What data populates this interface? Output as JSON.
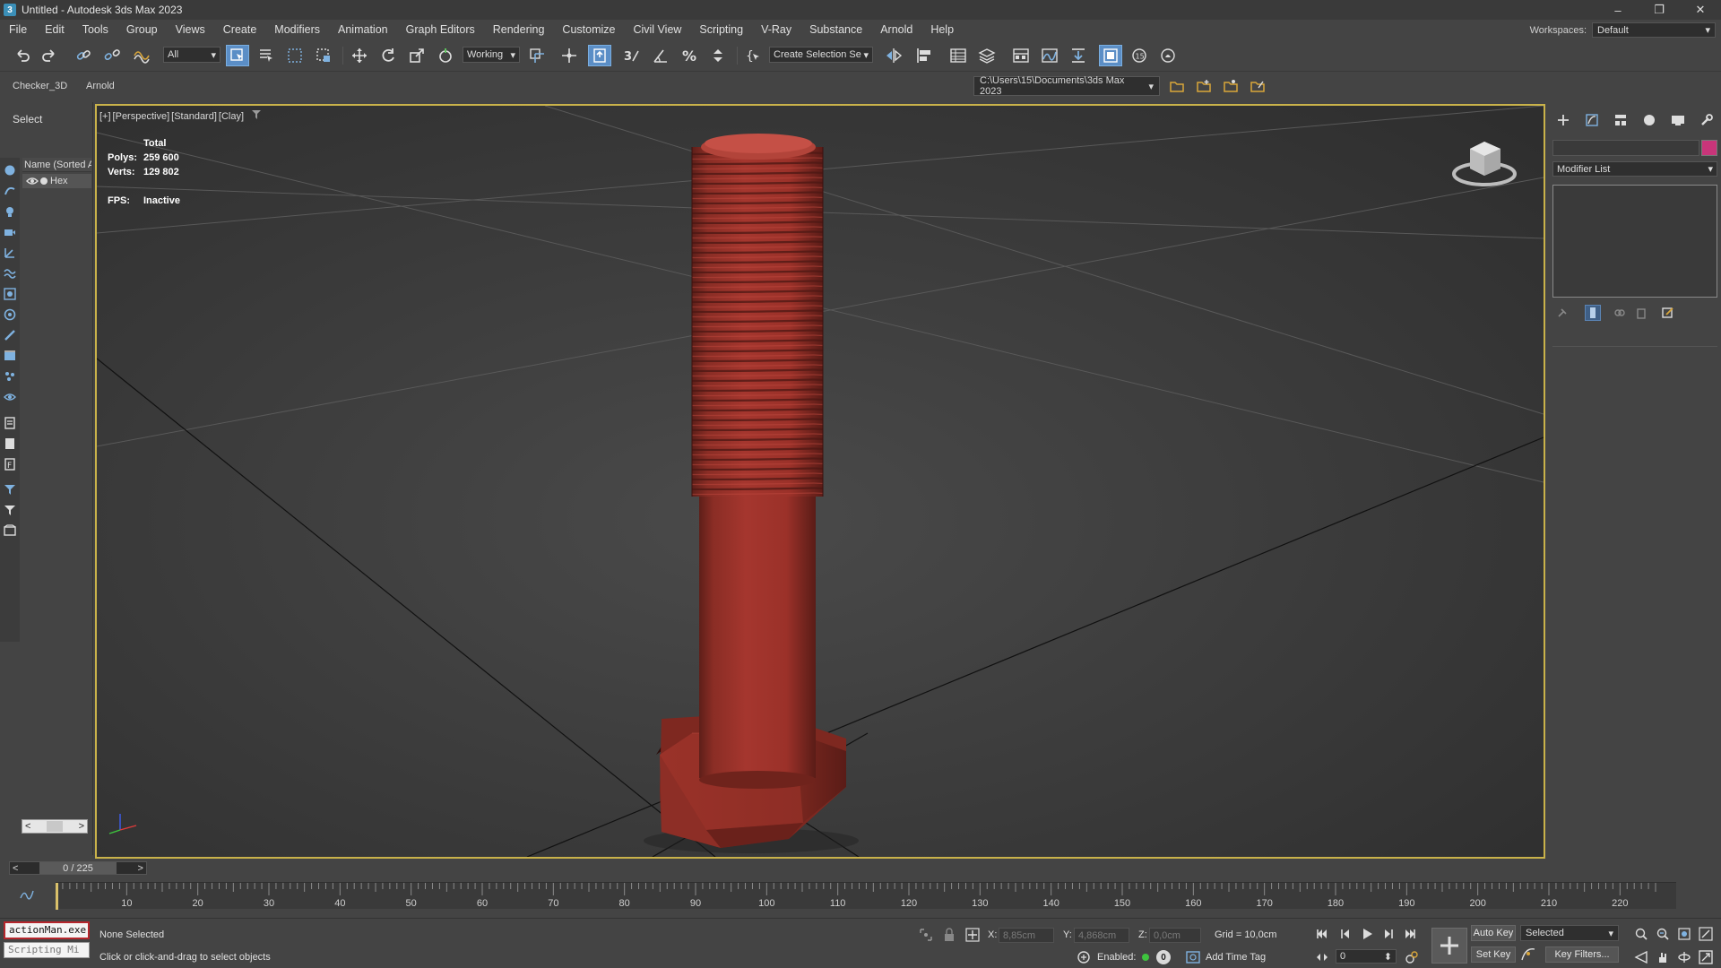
{
  "window": {
    "app_icon": "3",
    "title": "Untitled - Autodesk 3ds Max 2023",
    "controls": {
      "minimize": "–",
      "restore": "❐",
      "close": "✕"
    }
  },
  "menu": {
    "items": [
      "File",
      "Edit",
      "Tools",
      "Group",
      "Views",
      "Create",
      "Modifiers",
      "Animation",
      "Graph Editors",
      "Rendering",
      "Customize",
      "Civil View",
      "Scripting",
      "V-Ray",
      "Substance",
      "Arnold",
      "Help"
    ]
  },
  "workspace": {
    "label": "Workspaces:",
    "value": "Default"
  },
  "toolbar": {
    "selection_filter": "All",
    "reference_coord": "Working",
    "named_selection": "Create Selection Se",
    "spinner_snap_value": "15"
  },
  "ribbon": {
    "tabs": [
      "Checker_3D",
      "Arnold"
    ],
    "project_path": "C:\\Users\\15\\Documents\\3ds Max 2023"
  },
  "explorer": {
    "select_label": "Select",
    "column_header": "Name (Sorted A",
    "rows": [
      {
        "name": "Hex"
      }
    ],
    "scroll_left": "<",
    "scroll_right": ">"
  },
  "viewport": {
    "label_parts": [
      "[+]",
      "[Perspective]",
      "[Standard]",
      "[Clay]"
    ],
    "stats": {
      "header": "Total",
      "polys_label": "Polys:",
      "polys_value": "259 600",
      "verts_label": "Verts:",
      "verts_value": "129 802",
      "fps_label": "FPS:",
      "fps_value": "Inactive"
    },
    "model_color": "#a5362e",
    "active_border_color": "#c9b24a"
  },
  "command_panel": {
    "modifier_list": "Modifier List",
    "object_color": "#c9357a"
  },
  "time": {
    "slider_text": "0 / 225",
    "slider_prev": "<",
    "slider_next": ">",
    "ruler_labels": [
      "10",
      "20",
      "30",
      "40",
      "50",
      "60",
      "70",
      "80",
      "90",
      "100",
      "110",
      "120",
      "130",
      "140",
      "150",
      "160",
      "170",
      "180",
      "190",
      "200",
      "210",
      "220"
    ],
    "total_frames": 225,
    "current_frame": 0
  },
  "status": {
    "maxscript_line1": "actionMan.exe",
    "maxscript_line2": "Scripting Mi",
    "selection": "None Selected",
    "prompt": "Click or click-and-drag to select objects",
    "x_label": "X:",
    "x_value": "8,85cm",
    "y_label": "Y:",
    "y_value": "4,868cm",
    "z_label": "Z:",
    "z_value": "0,0cm",
    "grid": "Grid = 10,0cm",
    "enabled_label": "Enabled:",
    "enabled_count": "0",
    "add_time_tag": "Add Time Tag",
    "auto_key": "Auto Key",
    "set_key": "Set Key",
    "key_mode": "Selected",
    "key_filters": "Key Filters...",
    "frame_value": "0"
  }
}
